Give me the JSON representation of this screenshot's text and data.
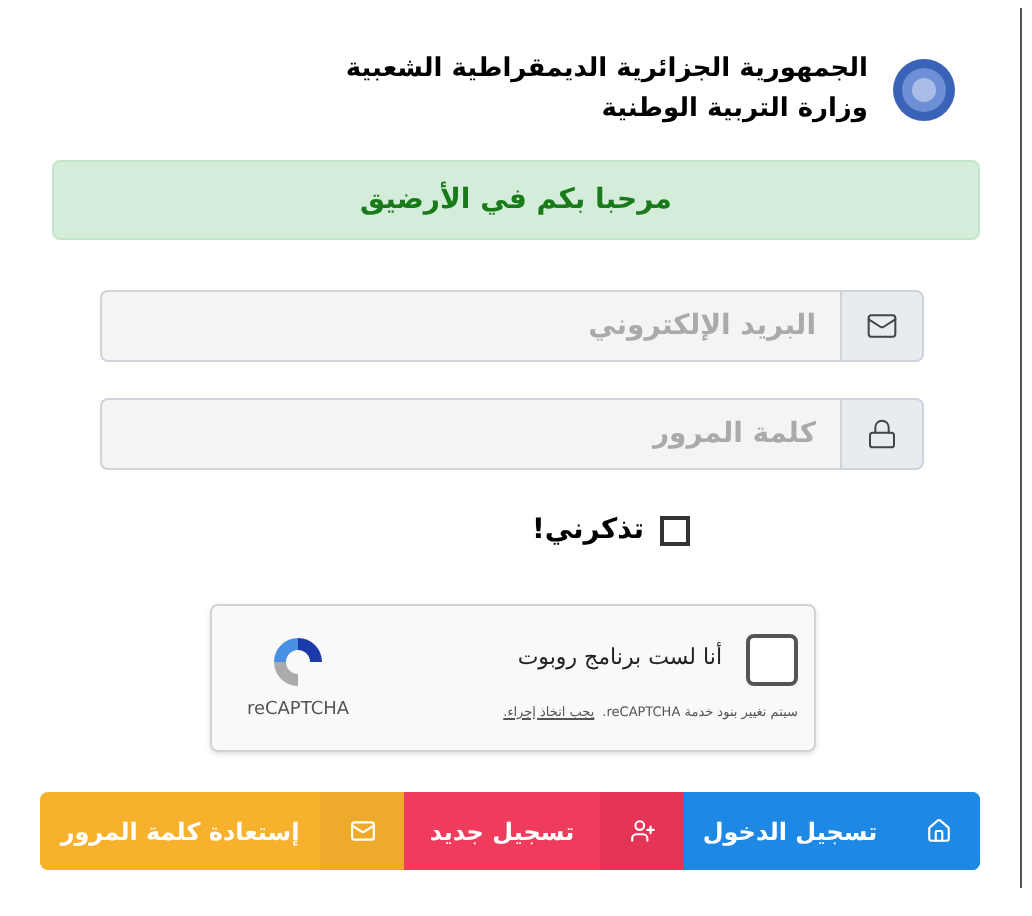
{
  "header": {
    "line_1": "الجمهورية الجزائرية الديمقراطية الشعبية",
    "line_2": "وزارة التربية الوطنية"
  },
  "alert": {
    "text": "مرحبا بكم في الأرضيق"
  },
  "fields": [
    {
      "kind": "email",
      "placeholder": "البريد الإلكتروني"
    },
    {
      "kind": "password",
      "placeholder": "كلمة المرور"
    }
  ],
  "remember": {
    "label": "تذكرني!",
    "checked": false
  },
  "captcha": {
    "label": "أنا لست برنامج روبوت",
    "checked": false,
    "brand": "reCAPTCHA",
    "notice": "سيتم تغيير بنود خدمة reCAPTCHA.",
    "notice_link": "يجب اتخاذ إجراء."
  },
  "buttons": [
    {
      "kind": "login",
      "label": "تسجيل الدخول"
    },
    {
      "kind": "register",
      "label": "تسجيل جديد"
    },
    {
      "kind": "recover",
      "label": "إستعادة كلمة المرور"
    }
  ]
}
